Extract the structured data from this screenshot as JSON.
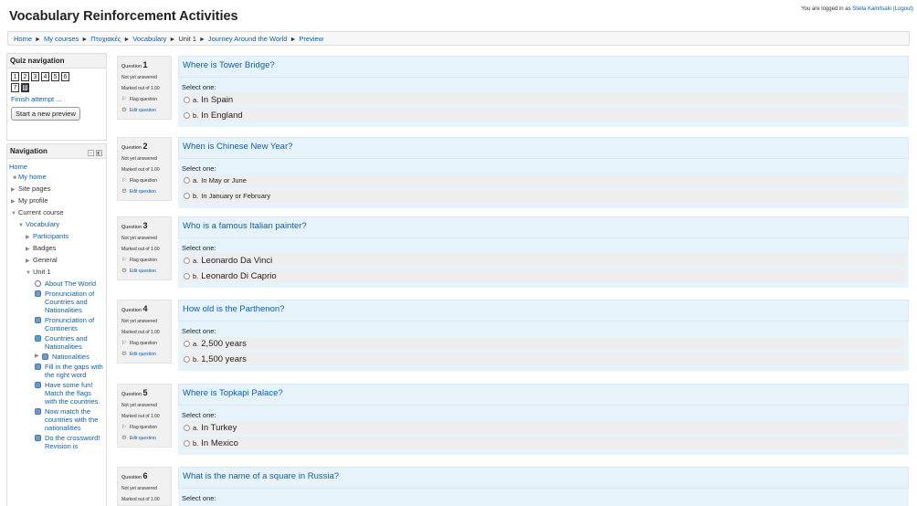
{
  "header": {
    "title": "Vocabulary Reinforcement Activities",
    "login_prefix": "You are logged in as",
    "user_name": "Stella Kamitsaki",
    "logout_label": "(Logout)"
  },
  "breadcrumb": {
    "items": [
      "Home",
      "My courses",
      "Πτυχιακές",
      "Vocabulary",
      "Unit 1",
      "Journey Around the World",
      "Preview"
    ],
    "separator": "►"
  },
  "quiz_nav": {
    "title": "Quiz navigation",
    "buttons": [
      "1",
      "2",
      "3",
      "4",
      "5",
      "6",
      "7",
      "8"
    ],
    "current": "8",
    "finish_label": "Finish attempt ...",
    "new_preview_label": "Start a new preview"
  },
  "navigation": {
    "title": "Navigation",
    "home": "Home",
    "my_home": "My home",
    "site_pages": "Site pages",
    "my_profile": "My profile",
    "current_course": "Current course",
    "vocabulary": "Vocabulary",
    "participants": "Participants",
    "badges": "Badges",
    "general": "General",
    "unit1": "Unit 1",
    "activities": [
      "About The World",
      "Pronunciation of Countries and Nationalities",
      "Pronunciation of Continents",
      "Countries and Nationalities",
      "Nationalities",
      "Fill in the gaps with the right word",
      "Have some fun! Match the flags with the countries.",
      "Now match the countries with the nationalities",
      "Do the crossword! Revision is"
    ]
  },
  "questions": [
    {
      "label": "Question",
      "number": "1",
      "state": "Not yet answered",
      "mark": "Marked out of 1.00",
      "flag": "Flag question",
      "edit": "Edit question",
      "text": "Where is Tower Bridge?",
      "prompt": "Select one:",
      "options": [
        {
          "letter": "a.",
          "text": "In Spain"
        },
        {
          "letter": "b.",
          "text": "In England"
        }
      ]
    },
    {
      "label": "Question",
      "number": "2",
      "state": "Not yet answered",
      "mark": "Marked out of 1.00",
      "flag": "Flag question",
      "edit": "Edit question",
      "text": "When is Chinese New Year?",
      "prompt": "Select one:",
      "options": [
        {
          "letter": "a.",
          "text": "In May or June"
        },
        {
          "letter": "b.",
          "text": "In January or February"
        }
      ]
    },
    {
      "label": "Question",
      "number": "3",
      "state": "Not yet answered",
      "mark": "Marked out of 1.00",
      "flag": "Flag question",
      "edit": "Edit question",
      "text": "Who is a famous Italian painter?",
      "prompt": "Select one:",
      "options": [
        {
          "letter": "a.",
          "text": "Leonardo Da Vinci"
        },
        {
          "letter": "b.",
          "text": "Leonardo Di Caprio"
        }
      ]
    },
    {
      "label": "Question",
      "number": "4",
      "state": "Not yet answered",
      "mark": "Marked out of 1.00",
      "flag": "Flag question",
      "edit": "Edit question",
      "text": "How old is the Parthenon?",
      "prompt": "Select one:",
      "options": [
        {
          "letter": "a.",
          "text": "2,500 years"
        },
        {
          "letter": "b.",
          "text": "1,500 years"
        }
      ]
    },
    {
      "label": "Question",
      "number": "5",
      "state": "Not yet answered",
      "mark": "Marked out of 1.00",
      "flag": "Flag question",
      "edit": "Edit question",
      "text": "Where is Topkapi Palace?",
      "prompt": "Select one:",
      "options": [
        {
          "letter": "a.",
          "text": "In Turkey"
        },
        {
          "letter": "b.",
          "text": "In Mexico"
        }
      ]
    },
    {
      "label": "Question",
      "number": "6",
      "state": "Not yet answered",
      "mark": "Marked out of 1.00",
      "text": "What is the name of a square in Russia?",
      "prompt": "Select one:"
    }
  ]
}
